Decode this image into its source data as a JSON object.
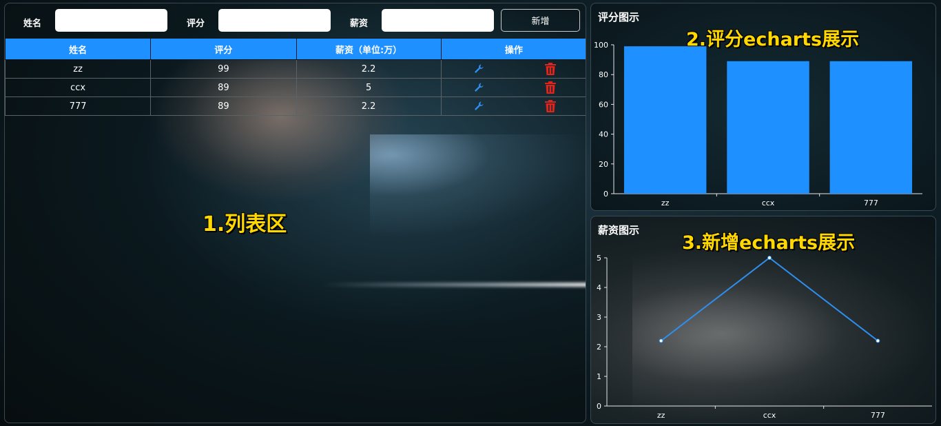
{
  "form": {
    "name_label": "姓名",
    "name_value": "",
    "score_label": "评分",
    "score_value": "",
    "salary_label": "薪资",
    "salary_value": "",
    "add_button": "新增"
  },
  "table": {
    "headers": [
      "姓名",
      "评分",
      "薪资（单位:万）",
      "操作"
    ],
    "rows": [
      {
        "name": "zz",
        "score": "99",
        "salary": "2.2"
      },
      {
        "name": "ccx",
        "score": "89",
        "salary": "5"
      },
      {
        "name": "777",
        "score": "89",
        "salary": "2.2"
      }
    ]
  },
  "annotations": {
    "list": "1.列表区",
    "score_chart": "2.评分echarts展示",
    "salary_chart": "3.新增echarts展示"
  },
  "icons": {
    "edit": "wrench-icon",
    "delete": "trash-icon"
  },
  "colors": {
    "accent": "#1e90ff",
    "delete": "#e0241b",
    "annotation": "#ffd800"
  },
  "chart_data": [
    {
      "type": "bar",
      "title": "评分图示",
      "categories": [
        "zz",
        "ccx",
        "777"
      ],
      "values": [
        99,
        89,
        89
      ],
      "ylim": [
        0,
        100
      ],
      "yticks": [
        0,
        20,
        40,
        60,
        80,
        100
      ],
      "grid": false,
      "color": "#1e90ff"
    },
    {
      "type": "line",
      "title": "薪资图示",
      "categories": [
        "zz",
        "ccx",
        "777"
      ],
      "values": [
        2.2,
        5,
        2.2
      ],
      "ylim": [
        0,
        5
      ],
      "yticks": [
        0,
        1,
        2,
        3,
        4,
        5
      ],
      "grid": false,
      "color": "#2e8ff0"
    }
  ]
}
